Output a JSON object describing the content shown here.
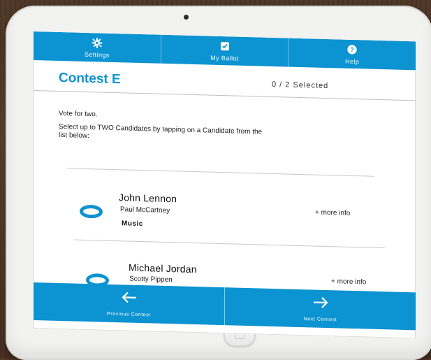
{
  "topbar": {
    "settings_label": "Settings",
    "ballot_label": "My Ballot",
    "help_label": "Help"
  },
  "header": {
    "contest_title": "Contest E",
    "selected_count": "0 / 2 Selected"
  },
  "instructions": {
    "line1": "Vote for two.",
    "line2": "Select up to TWO Candidates by tapping on a Candidate from the list below:"
  },
  "candidates": [
    {
      "name": "John Lennon",
      "running_mate": "Paul McCartney",
      "party": "Music",
      "more_info": "+ more info"
    },
    {
      "name": "Michael Jordan",
      "running_mate": "Scotty Pippen",
      "more_info": "+ more info"
    }
  ],
  "bottombar": {
    "previous_label": "Previous Contest",
    "next_label": "Next Contest"
  },
  "colors": {
    "accent": "#0c93d1"
  },
  "icons": {
    "settings": "gear-icon",
    "ballot": "checkbox-icon",
    "help": "help-icon",
    "previous": "arrow-left-icon",
    "next": "arrow-right-icon"
  }
}
